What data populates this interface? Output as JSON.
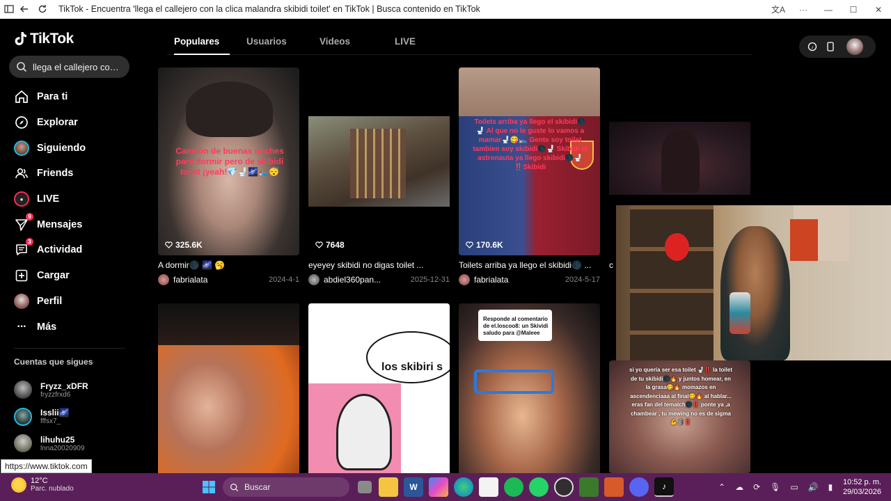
{
  "window": {
    "title": "TikTok - Encuentra 'llega el callejero con la clica malandra skibidi toilet' en TikTok | Busca contenido en TikTok"
  },
  "app": {
    "logo_text": "TikTok",
    "search_value": "llega el callejero con l...",
    "nav": [
      {
        "label": "Para ti",
        "icon": "home-icon"
      },
      {
        "label": "Explorar",
        "icon": "compass-icon"
      },
      {
        "label": "Siguiendo",
        "icon": "following-avatar-icon"
      },
      {
        "label": "Friends",
        "icon": "friends-icon"
      },
      {
        "label": "LIVE",
        "icon": "live-icon"
      },
      {
        "label": "Mensajes",
        "icon": "send-icon",
        "badge": "9"
      },
      {
        "label": "Actividad",
        "icon": "message-icon",
        "badge": "3"
      },
      {
        "label": "Cargar",
        "icon": "upload-icon"
      },
      {
        "label": "Perfil",
        "icon": "profile-avatar-icon"
      },
      {
        "label": "Más",
        "icon": "more-icon"
      }
    ],
    "following_title": "Cuentas que sigues",
    "following": [
      {
        "name": "Fryzz_xDFR",
        "handle": "fryzzfrxd6"
      },
      {
        "name": "Isslii🌌",
        "handle": "fffsx7_"
      },
      {
        "name": "lihuhu25",
        "handle": "lnna20020909"
      }
    ],
    "url_tooltip": "https://www.tiktok.com",
    "tabs": [
      "Populares",
      "Usuarios",
      "Videos",
      "LIVE"
    ],
    "active_tab": "Populares"
  },
  "videos": [
    {
      "likes": "325.6K",
      "desc": "A dormir🌑 🌌 🥱",
      "user": "fabrialata",
      "date": "2024-4-1",
      "overlay": "Canción de buenas noches para dormir pero de skibidi toilet ¡yeah!💎🚽🌌🛌😴"
    },
    {
      "likes": "7648",
      "desc": "eyeyey skibidi no digas toilet ...",
      "user": "abdiel360pan...",
      "date": "2025-12-31",
      "overlay": ""
    },
    {
      "likes": "170.6K",
      "desc": "Toilets arriba ya llego el skibidi🌑 ...",
      "user": "fabrialata",
      "date": "2024-5-17",
      "overlay": "Toilets arriba ya llego el skibidi🌑🚽 Al que no le guste lo vamos a mamar🚽😋🛌 Gente soy toilet tambien soy skibidi🌑🚽 Skibidi el astronauta ya llego skibidi🌑🚽 ‼️Skibidi"
    },
    {
      "likes": "",
      "desc": "c",
      "user": "",
      "date": "",
      "overlay": ""
    },
    {
      "likes": "",
      "desc": "",
      "user": "",
      "date": "",
      "overlay": ""
    },
    {
      "likes": "",
      "desc": "",
      "user": "",
      "date": "",
      "overlay": "los skibiri s"
    },
    {
      "likes": "",
      "desc": "",
      "user": "",
      "date": "",
      "overlay": "Responde al comentario de el.loscoo8: un Skividi saludo para @Maleee"
    },
    {
      "likes": "",
      "desc": "",
      "user": "",
      "date": "",
      "overlay": "si yo quería ser esa toilet 🚽‼️ la toilet de tu skibidi🌑🔥 y juntos homear, en la grasa😋🔥 momazos en ascendenciaaa al final😋🔥 al hablar... eras fan del tematch🌑‼️ ponte ya ,a chambear , tu mewing no es de sigma💪🗿‼️"
    }
  ],
  "taskbar": {
    "temp": "12°C",
    "weather": "Parc. nublado",
    "search_placeholder": "Buscar",
    "time": "10:52 p. m.",
    "date": "29/03/2026"
  },
  "colors": {
    "accent": "#fe2c55",
    "taskbar": "#5a1f58"
  }
}
